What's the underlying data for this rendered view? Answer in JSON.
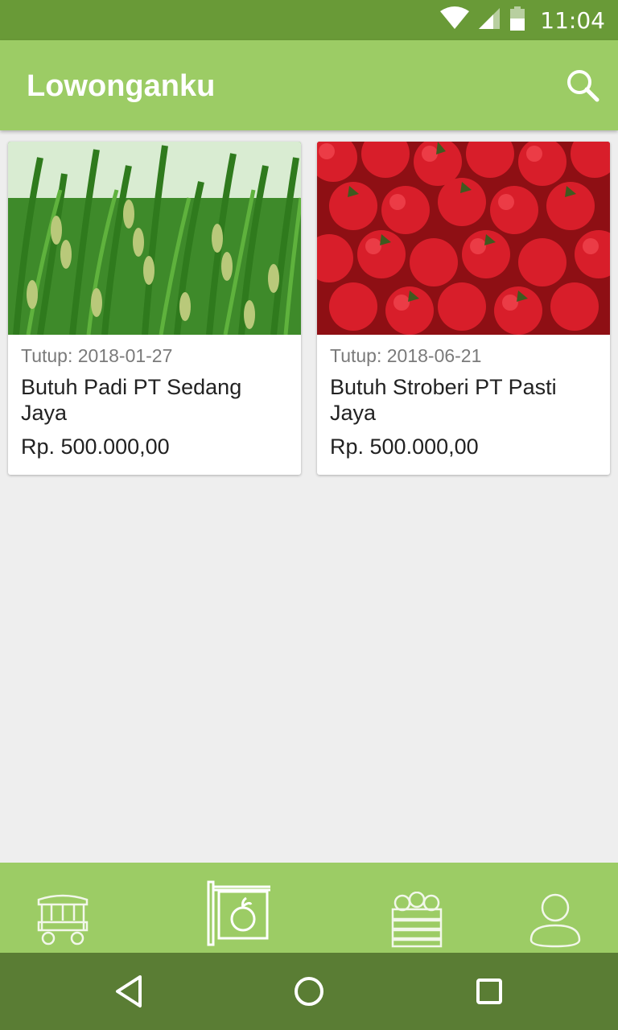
{
  "status_bar": {
    "time": "11:04",
    "icons": [
      "wifi-icon",
      "signal-icon",
      "battery-icon"
    ]
  },
  "app_bar": {
    "title": "Lowonganku",
    "search_icon": "search-icon"
  },
  "jobs": [
    {
      "image": "rice-plant-photo",
      "close_label": "Tutup: 2018-01-27",
      "title": "Butuh Padi PT Sedang Jaya",
      "price": "Rp. 500.000,00"
    },
    {
      "image": "strawberries-photo",
      "close_label": "Tutup: 2018-06-21",
      "title": "Butuh Stroberi PT Pasti Jaya",
      "price": "Rp. 500.000,00"
    }
  ],
  "bottom_nav": {
    "items": [
      "market-cart-icon",
      "fruit-sign-icon",
      "produce-crate-icon",
      "profile-icon"
    ],
    "active_index": 1
  },
  "system_nav": [
    "back-icon",
    "home-icon",
    "recents-icon"
  ],
  "colors": {
    "status_bar": "#699a37",
    "app_bar": "#9ccc65",
    "bottom_nav": "#9ccc65",
    "system_nav": "#5a7d34",
    "background": "#eeeeee"
  }
}
